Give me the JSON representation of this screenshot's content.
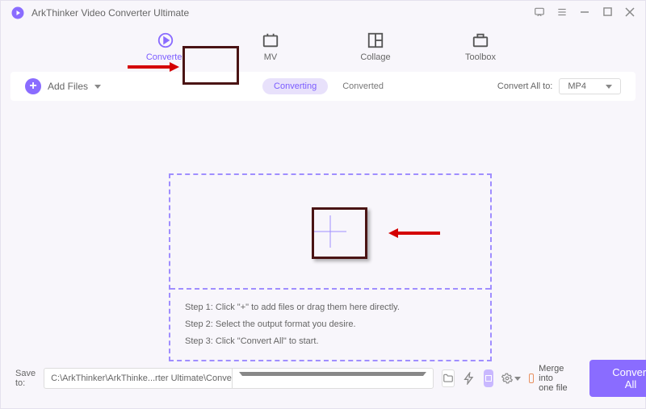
{
  "title": "ArkThinker Video Converter Ultimate",
  "tabs": {
    "converter": "Converter",
    "mv": "MV",
    "collage": "Collage",
    "toolbox": "Toolbox"
  },
  "toolbar": {
    "add_files": "Add Files",
    "seg_converting": "Converting",
    "seg_converted": "Converted",
    "convert_all_to": "Convert All to:",
    "format": "MP4"
  },
  "dropzone": {
    "step1": "Step 1: Click \"+\" to add files or drag them here directly.",
    "step2": "Step 2: Select the output format you desire.",
    "step3": "Step 3: Click \"Convert All\" to start."
  },
  "footer": {
    "save_to": "Save to:",
    "path": "C:\\ArkThinker\\ArkThinke...rter Ultimate\\Converted",
    "merge": "Merge into one file",
    "convert_all": "Convert All"
  }
}
